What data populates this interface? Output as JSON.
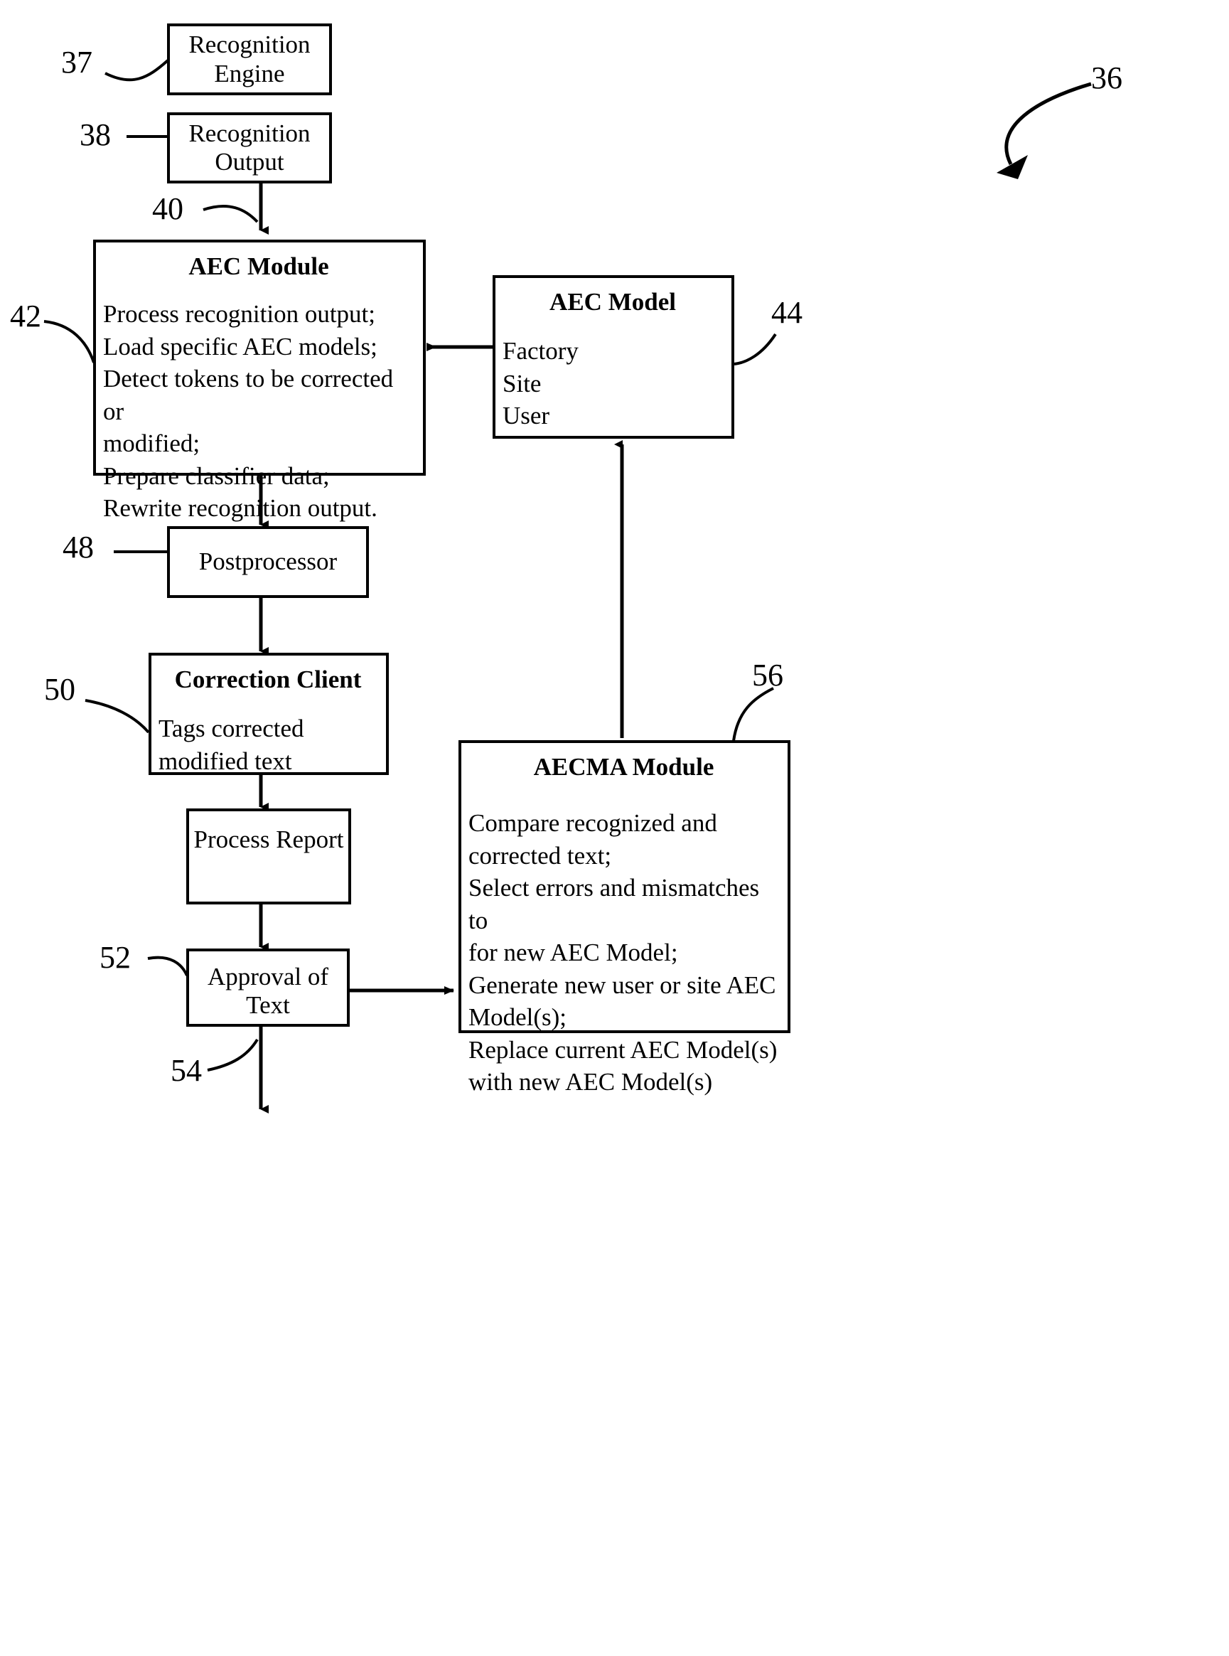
{
  "figure": {
    "type": "patent-block-diagram",
    "overall_reference": "36"
  },
  "boxes": {
    "recognition_engine": {
      "title": "Recognition\nEngine",
      "ref": "37"
    },
    "recognition_output": {
      "title": "Recognition\nOutput",
      "ref": "38"
    },
    "aec_module": {
      "title": "AEC Module",
      "ref_top": "40",
      "ref_side": "42",
      "body": "Process recognition output;\nLoad specific AEC models;\nDetect tokens to be corrected or\nmodified;\nPrepare classifier data;\nRewrite recognition output."
    },
    "aec_model": {
      "title": "AEC Model",
      "ref": "44",
      "body": "Factory\nSite\nUser"
    },
    "postprocessor": {
      "title": "Postprocessor",
      "ref": "48"
    },
    "correction_client": {
      "title": "Correction Client",
      "ref": "50",
      "body": "Tags corrected\nmodified text"
    },
    "process_report": {
      "title": "Process Report"
    },
    "approval_of_text": {
      "title": "Approval of\nText",
      "ref": "52",
      "ref_output": "54"
    },
    "aecma_module": {
      "title": "AECMA Module",
      "ref": "56",
      "body": "Compare recognized and\ncorrected text;\nSelect errors and mismatches to\nfor new AEC Model;\nGenerate new user or site AEC\nModel(s);\nReplace current AEC Model(s)\nwith new AEC Model(s)"
    }
  },
  "numerals": {
    "n36": "36",
    "n37": "37",
    "n38": "38",
    "n40": "40",
    "n42": "42",
    "n44": "44",
    "n48": "48",
    "n50": "50",
    "n52": "52",
    "n54": "54",
    "n56": "56"
  },
  "colors": {
    "stroke": "#000000",
    "background": "#ffffff"
  }
}
